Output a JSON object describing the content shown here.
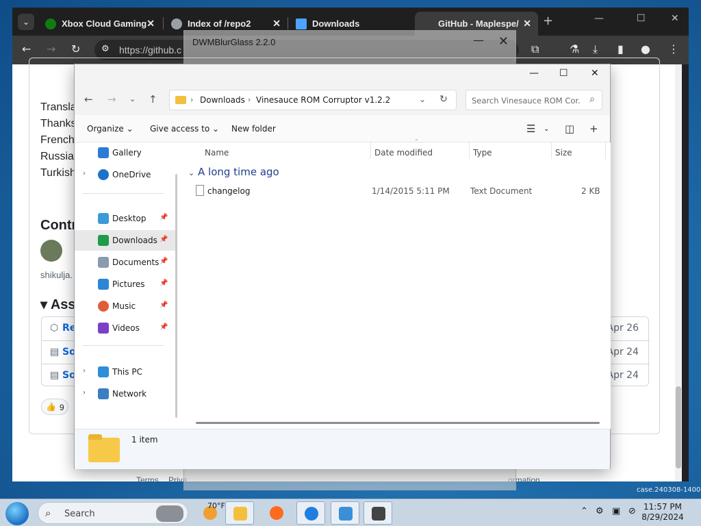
{
  "browser": {
    "tabs": [
      {
        "title": "Xbox Cloud Gaming",
        "icon": "xbox-icon",
        "color": "#107c10"
      },
      {
        "title": "Index of /repo2",
        "icon": "globe-icon",
        "color": "#9aa0a6"
      },
      {
        "title": "Downloads",
        "icon": "download-icon",
        "color": "#4da3ff"
      },
      {
        "title": "GitHub - Maplespe/",
        "icon": "github-icon",
        "color": "#ffffff"
      }
    ],
    "url": "https://github.c",
    "page": {
      "lines": [
        "Transla",
        "Thanks",
        "French",
        "Russian",
        "Turkish"
      ],
      "contributors_heading": "Contr",
      "contributor_name": "shikulja.",
      "assets_heading": "Asse",
      "asset_rows": [
        {
          "label": "Re",
          "date": "Apr 26"
        },
        {
          "label": "So",
          "date": "Apr 24"
        },
        {
          "label": "So",
          "date": "Apr 24"
        }
      ],
      "reaction_count": "9",
      "footer": {
        "terms": "Terms",
        "privacy": "Priva",
        "information": "ormation"
      }
    }
  },
  "ghost_window": {
    "title": "DWMBlurGlass 2.2.0"
  },
  "explorer": {
    "address": {
      "parts": [
        "Downloads",
        "Vinesauce ROM Corruptor v1.2.2"
      ]
    },
    "search_placeholder": "Search Vinesauce ROM Cor...",
    "commands": {
      "organize": "Organize",
      "give_access": "Give access to",
      "new_folder": "New folder"
    },
    "nav": [
      {
        "label": "Gallery",
        "icon": "gallery-icon",
        "color": "#2b7bd6",
        "pinned": false,
        "expandable": false
      },
      {
        "label": "OneDrive",
        "icon": "cloud-icon",
        "color": "#1b73c9",
        "pinned": false,
        "expandable": true
      },
      {
        "label": "Desktop",
        "icon": "desktop-icon",
        "color": "#3d9ad6",
        "pinned": true,
        "expandable": false
      },
      {
        "label": "Downloads",
        "icon": "download-icon",
        "color": "#1e9b4b",
        "pinned": true,
        "expandable": false,
        "selected": true
      },
      {
        "label": "Documents",
        "icon": "documents-icon",
        "color": "#8a9bb0",
        "pinned": true,
        "expandable": false
      },
      {
        "label": "Pictures",
        "icon": "pictures-icon",
        "color": "#2b86d6",
        "pinned": true,
        "expandable": false
      },
      {
        "label": "Music",
        "icon": "music-icon",
        "color": "#e05d3a",
        "pinned": true,
        "expandable": false
      },
      {
        "label": "Videos",
        "icon": "videos-icon",
        "color": "#7d3fc4",
        "pinned": true,
        "expandable": false
      },
      {
        "label": "This PC",
        "icon": "computer-icon",
        "color": "#2e8fd8",
        "pinned": false,
        "expandable": true
      },
      {
        "label": "Network",
        "icon": "network-icon",
        "color": "#3a7fc2",
        "pinned": false,
        "expandable": true
      }
    ],
    "columns": [
      "Name",
      "Date modified",
      "Type",
      "Size"
    ],
    "group": "A long time ago",
    "files": [
      {
        "name": "changelog",
        "date": "1/14/2015 5:11 PM",
        "type": "Text Document",
        "size": "2 KB"
      }
    ],
    "status": "1 item"
  },
  "taskbar": {
    "search_placeholder": "Search",
    "weather": "70°F",
    "time": "11:57 PM",
    "date": "8/29/2024",
    "watermark": "case.240308-1400"
  }
}
